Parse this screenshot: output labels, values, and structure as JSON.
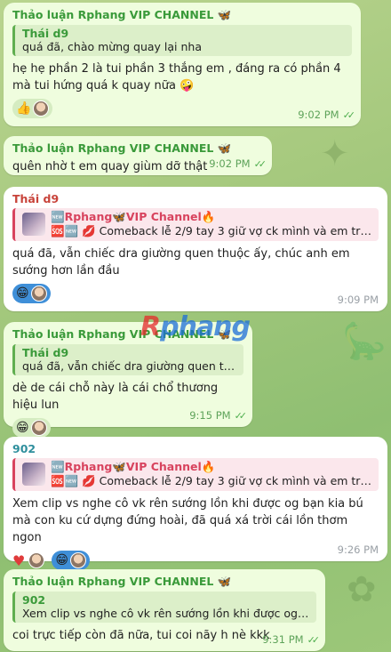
{
  "channel_name": "Thảo luận Rphang VIP CHANNEL",
  "channel_emoji": "🦋",
  "forward_title": "🆕Rphang🦋VIP Channel🔥",
  "forward_line": "Comeback lễ 2/9 tay 3 giữ vợ ck mình và em trai...",
  "forward_prefix_icons": "🆘🆕 💋",
  "watermark": {
    "first": "R",
    "rest": "phang"
  },
  "messages": [
    {
      "id": "m1",
      "reply_author": "Thái d9",
      "reply_text": "quá đã, chào mừng quay lại nha",
      "text": "hẹ hẹ phần 2 là tui phần 3 thắng em , đáng ra có phần 4 mà tui hứng quá k quay nữa 🤪",
      "reaction": "👍",
      "time": "9:02 PM"
    },
    {
      "id": "m2",
      "text": "quên nhờ t em quay giùm dỡ thật",
      "time": "9:02 PM"
    },
    {
      "id": "m3",
      "sender": "Thái d9",
      "text": "quá đã, vẫn chiếc dra giường quen thuộc ấy, chúc anh em sướng hơn lần đầu",
      "reaction": "😁",
      "time": "9:09 PM"
    },
    {
      "id": "m4",
      "reply_author": "Thái d9",
      "reply_text": "quá đã, vẫn chiếc dra giường quen thu...",
      "text": "dè de cái chỗ này là cái chổ thương hiệu lun",
      "reaction": "😁",
      "time": "9:15 PM"
    },
    {
      "id": "m5",
      "sender": "902",
      "text": "Xem clip vs nghe cô vk rên sướng lồn khi được og bạn kia bú mà con ku cứ dựng đứng hoài, đã quá xá trời cái lồn thơm ngon",
      "reaction1": "♥",
      "reaction2": "😁",
      "time": "9:26 PM"
    },
    {
      "id": "m6",
      "reply_author": "902",
      "reply_text": "Xem clip vs nghe cô vk rên sướng lồn khi được og bạ...",
      "text": "coi trực tiếp còn đã nữa, tui coi nãy h nè kkk",
      "time": "9:31 PM"
    }
  ]
}
